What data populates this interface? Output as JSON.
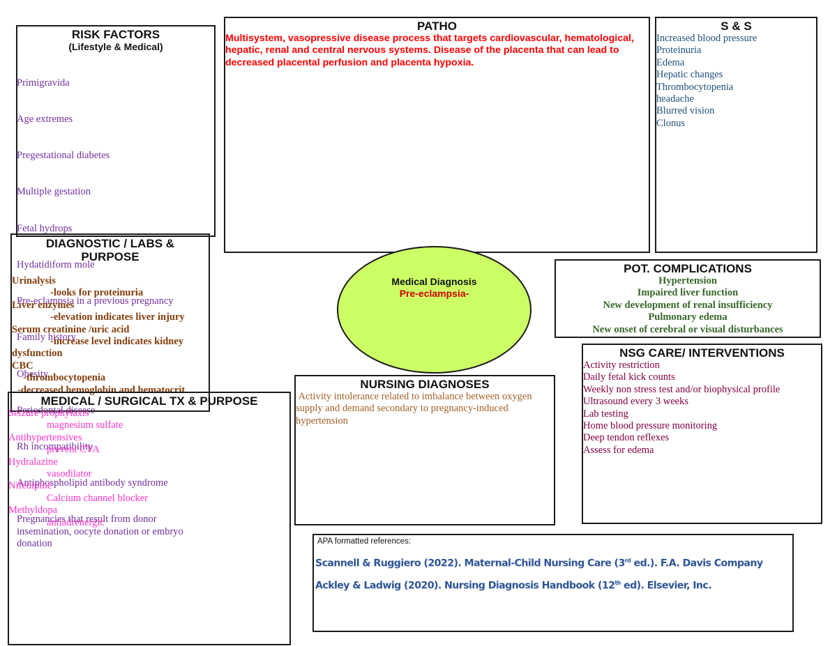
{
  "risk_factors": {
    "title": "RISK FACTORS",
    "subtitle": "(Lifestyle & Medical)",
    "items": [
      " Primigravida",
      "Age extremes",
      "Pregestational diabetes",
      "Multiple gestation",
      "Fetal hydrops",
      "Hydatidiform mole",
      "Pre-eclampsia in a previous pregnancy",
      "Family history",
      "Obesity",
      "Periodontal disease",
      "Rh incompatibility",
      "Antiphospholipid antibody syndrome",
      "Pregnancies that result from donor insemination, oocyte donation or embryo donation"
    ]
  },
  "patho": {
    "title": "PATHO",
    "text": "Multisystem, vasopressive disease process that targets cardiovascular, hematological, hepatic, renal and central nervous systems. Disease of the placenta that can lead to decreased placental perfusion and placenta hypoxia."
  },
  "signs_symptoms": {
    "title": "S & S",
    "items": [
      "Increased blood pressure",
      "Proteinuria",
      "Edema",
      "Hepatic changes",
      "Thrombocytopenia",
      "headache",
      "Blurred vision",
      "Clonus"
    ]
  },
  "diagnostics": {
    "title_line1": "DIAGNOSTIC / LABS &",
    "title_line2": "PURPOSE",
    "items": [
      {
        "test": "Urinalysis",
        "purpose": "-looks for proteinuria"
      },
      {
        "test": "Liver enzymes",
        "purpose": "-elevation indicates liver injury"
      },
      {
        "test": "Serum creatinine /uric acid",
        "purpose": "-increase level indicates kidney dysfunction"
      }
    ],
    "cbc": {
      "test": "CBC",
      "findings": [
        "-thrombocytopenia",
        "-decreased hemoglobin and hematocrit"
      ]
    }
  },
  "medical_diagnosis": {
    "label": "Medical Diagnosis",
    "value": "Pre-eclampsia-",
    "fill_color": "#ccff66"
  },
  "complications": {
    "title": "POT. COMPLICATIONS",
    "items": [
      "Hypertension",
      "Impaired liver function",
      "New development of renal insufficiency",
      "Pulmonary edema",
      "New onset of cerebral or visual disturbances"
    ]
  },
  "nsg_care": {
    "title": "NSG CARE/ INTERVENTIONS",
    "items": [
      "Activity restriction",
      "Daily fetal kick counts",
      "Weekly non stress test and/or biophysical profile",
      "Ultrasound every 3 weeks",
      "Lab testing",
      "Home blood pressure monitoring",
      "Deep tendon reflexes",
      "Assess for edema"
    ]
  },
  "nursing_diagnoses": {
    "title": "NURSING DIAGNOSES",
    "text": " Activity intolerance related to imbalance between oxygen supply and demand secondary to pregnancy-induced hypertension"
  },
  "medical_tx": {
    "title": "MEDICAL / SURGICAL TX & PURPOSE",
    "items": [
      {
        "treatment": "Seizure prophylaxis",
        "purpose": "magnesium sulfate"
      },
      {
        "treatment": "Antihypertensives",
        "purpose": "prevent CVA"
      },
      {
        "treatment": "Hydralazine",
        "purpose": "vasodilator"
      },
      {
        "treatment": "Nifedipine",
        "purpose": "Calcium channel blocker"
      },
      {
        "treatment": "Methyldopa",
        "purpose": "antiadrenergic"
      }
    ]
  },
  "references": {
    "label": "APA formatted references:",
    "ref1": {
      "before": "Scannell & Ruggiero (2022). Maternal-Child Nursing Care (3",
      "sup": "rd",
      "after": " ed.). F.A. Davis Company"
    },
    "ref2": {
      "before": "Ackley & Ladwig (2020). Nursing Diagnosis Handbook (12",
      "sup": "th",
      "after": " ed).  Elsevier, Inc."
    }
  }
}
